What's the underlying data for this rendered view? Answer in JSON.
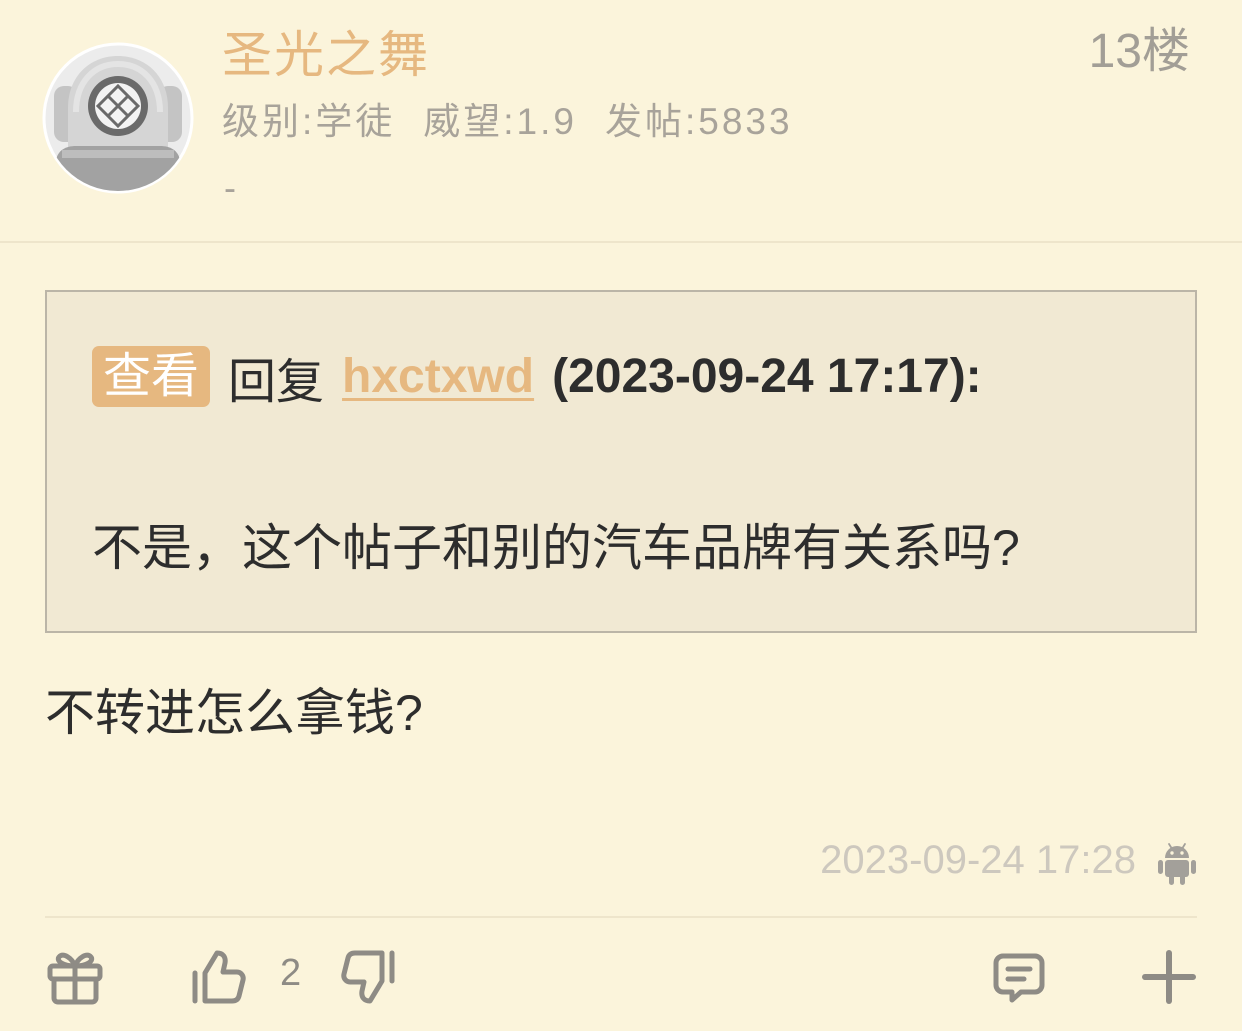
{
  "theme": {
    "background": "#FBF4DB",
    "accent": "#E6B880",
    "quote_background": "#F1E9D3",
    "text": "#2D2D2D",
    "muted": "#A8A39A",
    "icon": "#8E8B85"
  },
  "author": {
    "avatar_icon": "diver-helmet-icon",
    "username": "圣光之舞",
    "level": "级别:学徒",
    "prestige": "威望:1.9",
    "post_count": "发帖:5833",
    "signature": "-"
  },
  "post": {
    "floor": "13楼",
    "quote": {
      "view_label": "查看",
      "reply_label": "回复",
      "quoted_user": "hxctxwd",
      "quoted_time": "(2023-09-24 17:17):",
      "quoted_text": "不是，这个帖子和别的汽车品牌有关系吗?"
    },
    "content": "不转进怎么拿钱?",
    "timestamp": "2023-09-24 17:28",
    "device_icon": "android-icon"
  },
  "actions": {
    "gift_icon": "gift-icon",
    "like_icon": "thumbs-up-icon",
    "like_count": "2",
    "dislike_icon": "thumbs-down-icon",
    "reply_icon": "comment-icon",
    "more_icon": "plus-icon"
  }
}
